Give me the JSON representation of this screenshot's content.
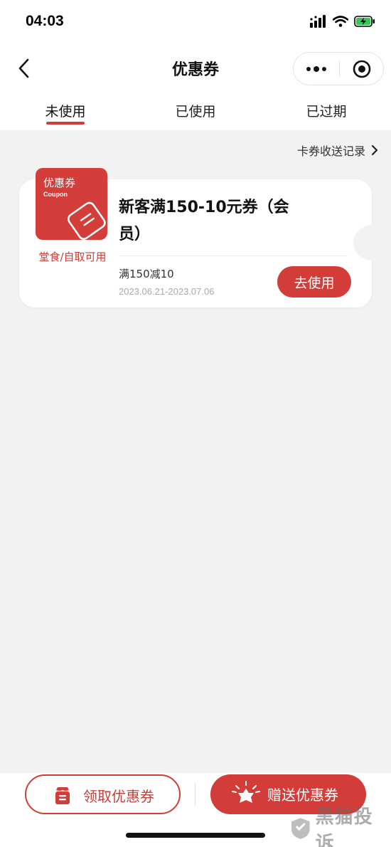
{
  "status_bar": {
    "time": "04:03"
  },
  "nav": {
    "title": "优惠券"
  },
  "tabs": [
    {
      "label": "未使用",
      "active": true
    },
    {
      "label": "已使用",
      "active": false
    },
    {
      "label": "已过期",
      "active": false
    }
  ],
  "record_link": {
    "label": "卡券收送记录"
  },
  "coupon": {
    "tile_title": "优惠券",
    "tile_subtitle": "Coupon",
    "usage_scope": "堂食/自取可用",
    "title": "新客满150-10元券（会员）",
    "rule": "满150减10",
    "valid_dates": "2023.06.21-2023.07.06",
    "action_label": "去使用"
  },
  "bottom": {
    "get_label": "领取优惠券",
    "send_label": "赠送优惠券"
  },
  "watermark": {
    "text": "黑猫投诉"
  },
  "colors": {
    "accent": "#d23d3a",
    "page_bg": "#f2f2f2",
    "card_bg": "#ffffff"
  },
  "icons": [
    "back-arrow",
    "more-dots",
    "target-circle",
    "chevron-right",
    "coupon-ticket",
    "gift-box",
    "gift-flower"
  ]
}
